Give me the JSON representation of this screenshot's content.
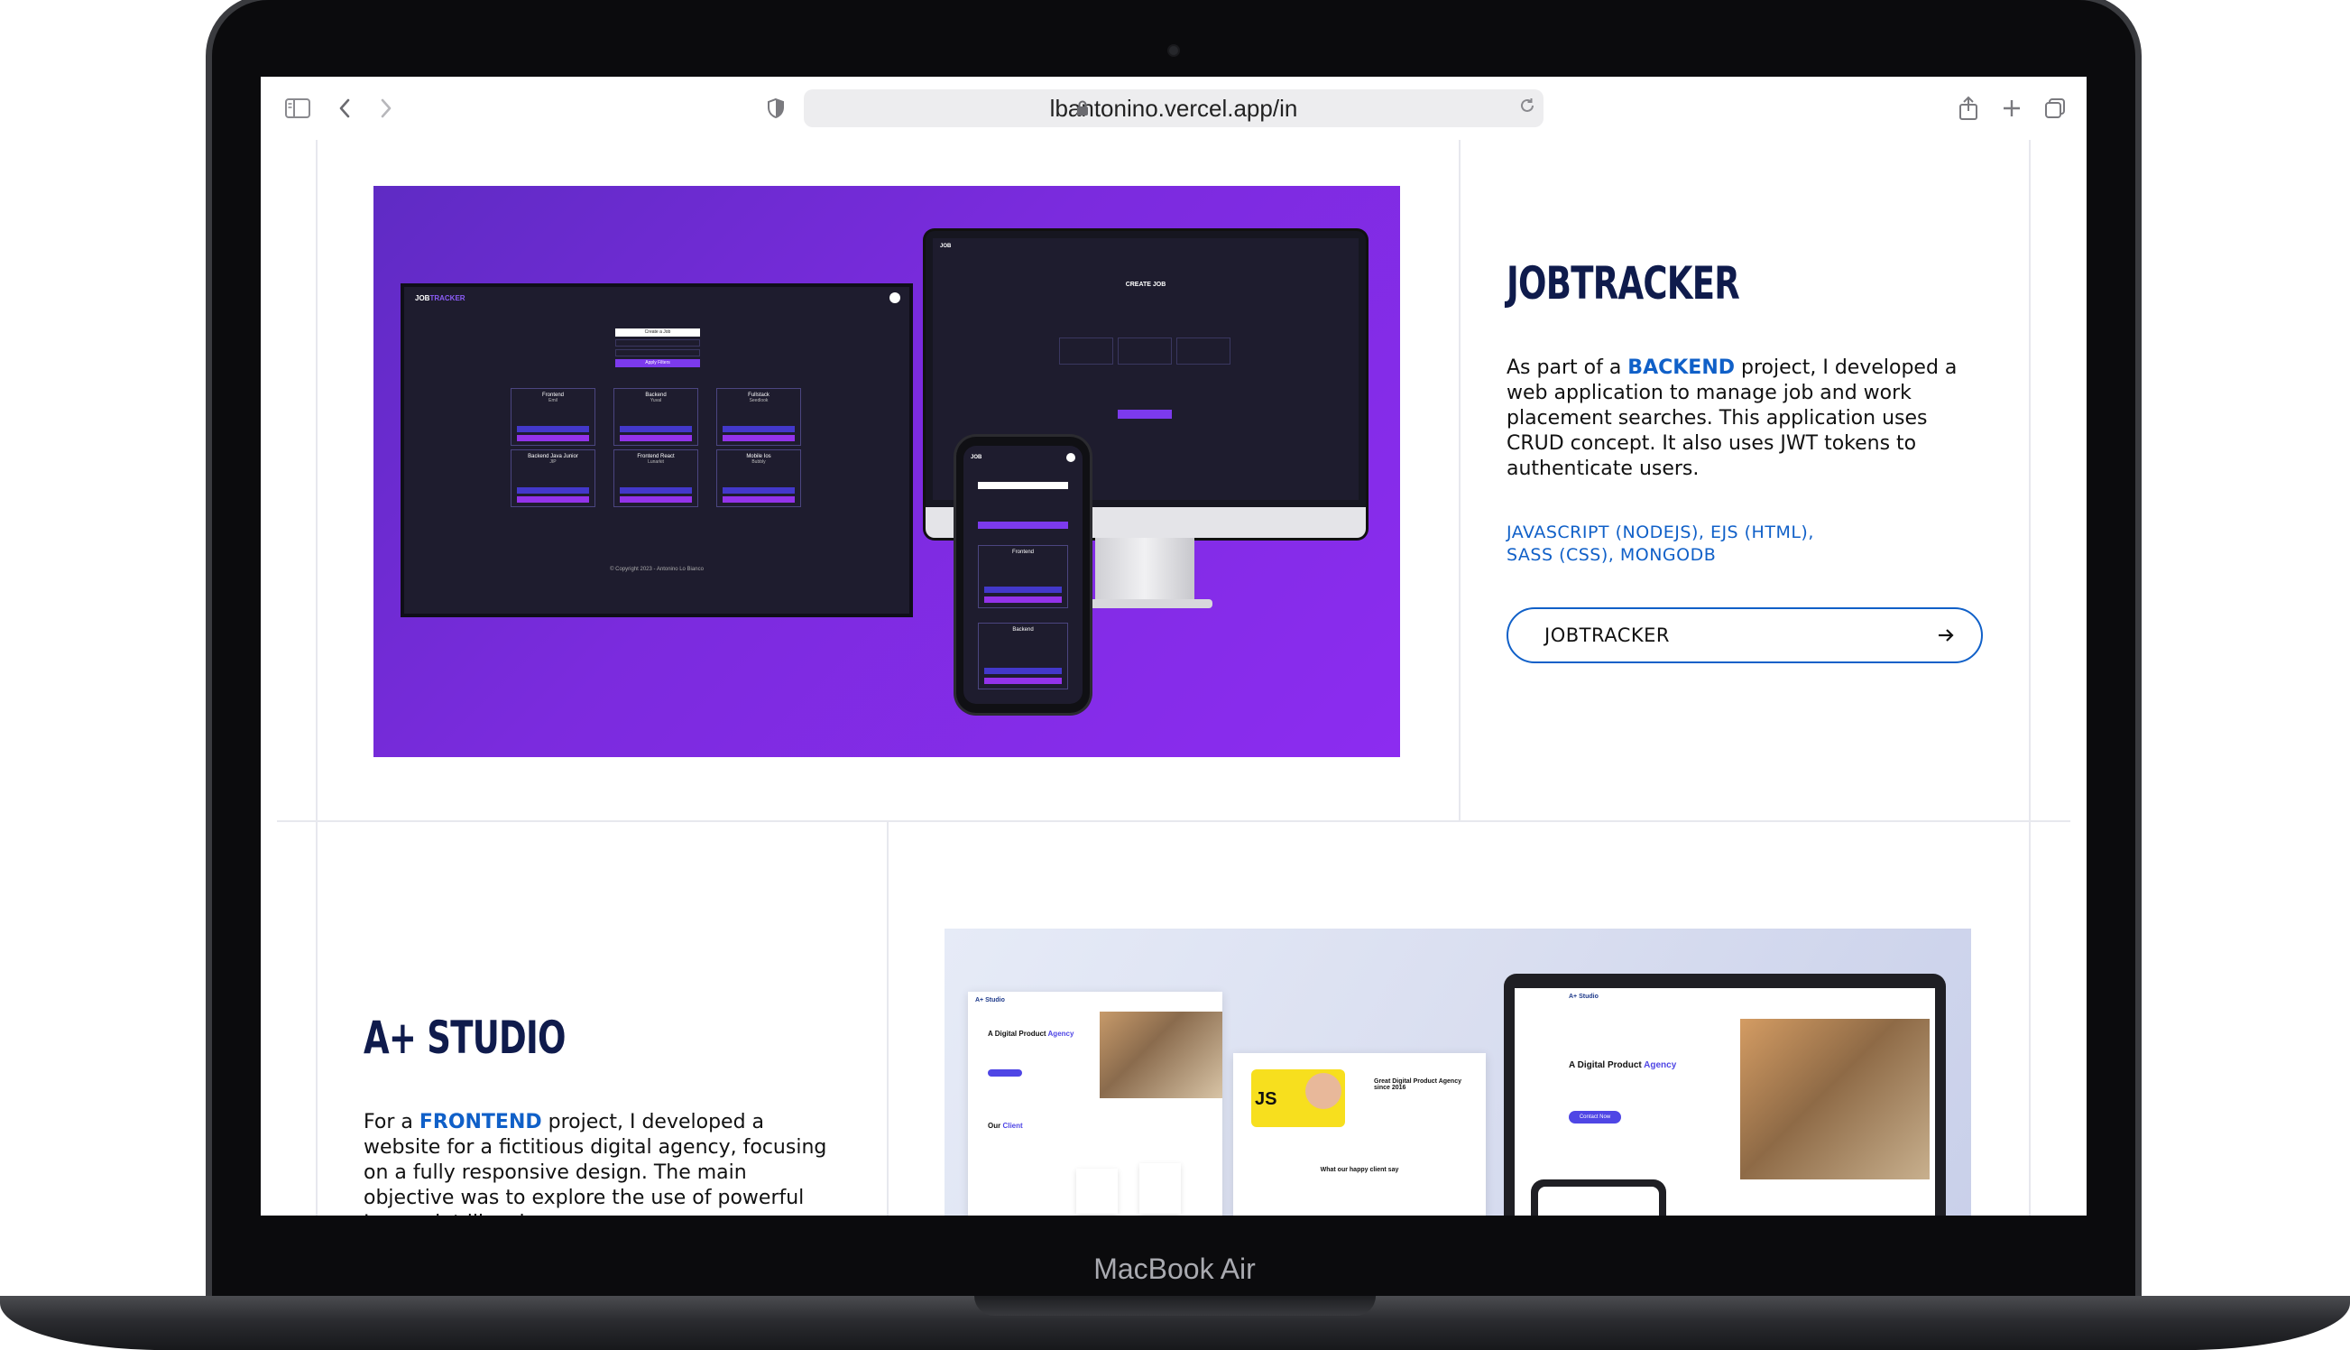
{
  "browser": {
    "url": "lbantonino.vercel.app/in"
  },
  "device": {
    "label": "MacBook Air"
  },
  "projects": [
    {
      "title": "JOBTRACKER",
      "desc_part1": "As part of a ",
      "desc_highlight": "BACKEND",
      "desc_part2": " project, I developed a web application to manage job and work placement searches. This application uses CRUD concept. It also uses JWT tokens to authenticate users.",
      "tech_line1": "JAVASCRIPT (NODEJS), EJS (HTML),",
      "tech_line2": "SASS (CSS), MONGODB",
      "link_label": "JOBTRACKER"
    },
    {
      "title": "A+ STUDIO",
      "desc_part1": "For a ",
      "desc_highlight": "FRONTEND",
      "desc_part2": " project, I developed a website for a fictitious digital agency, focusing on a fully responsive design. The main objective was to explore the use of powerful Javascript libraries."
    }
  ],
  "mockups": {
    "jobtracker_brand": "JOB",
    "jobtracker_brand_accent": "TRACKER",
    "create_job": "Create a Job",
    "apply_filters": "Apply Filters",
    "create_job_heading": "CREATE JOB",
    "copyright": "© Copyright 2023 - Antonino Lo Bianco",
    "cards": [
      {
        "title": "Frontend",
        "sub": "Emil"
      },
      {
        "title": "Backend",
        "sub": "Yuval"
      },
      {
        "title": "Fullstack",
        "sub": "Seedlook"
      },
      {
        "title": "Backend Java Junior",
        "sub": "JIP"
      },
      {
        "title": "Frontend React",
        "sub": "Lunarkit"
      },
      {
        "title": "Mobile Ios",
        "sub": "Bubbly"
      }
    ],
    "studio_brand": "A+ Studio",
    "studio_heading": "A Digital Product ",
    "studio_heading_accent": "Agency",
    "studio_clients": "Our ",
    "studio_clients_accent": "Client",
    "studio_great": "Great Digital Product Agency since 2016",
    "studio_happy": "What our happy client say",
    "studio_contact": "Contact Now"
  },
  "colors": {
    "accent": "#1060c8",
    "title": "#0f1b4c",
    "purple": "#7b2bde"
  }
}
